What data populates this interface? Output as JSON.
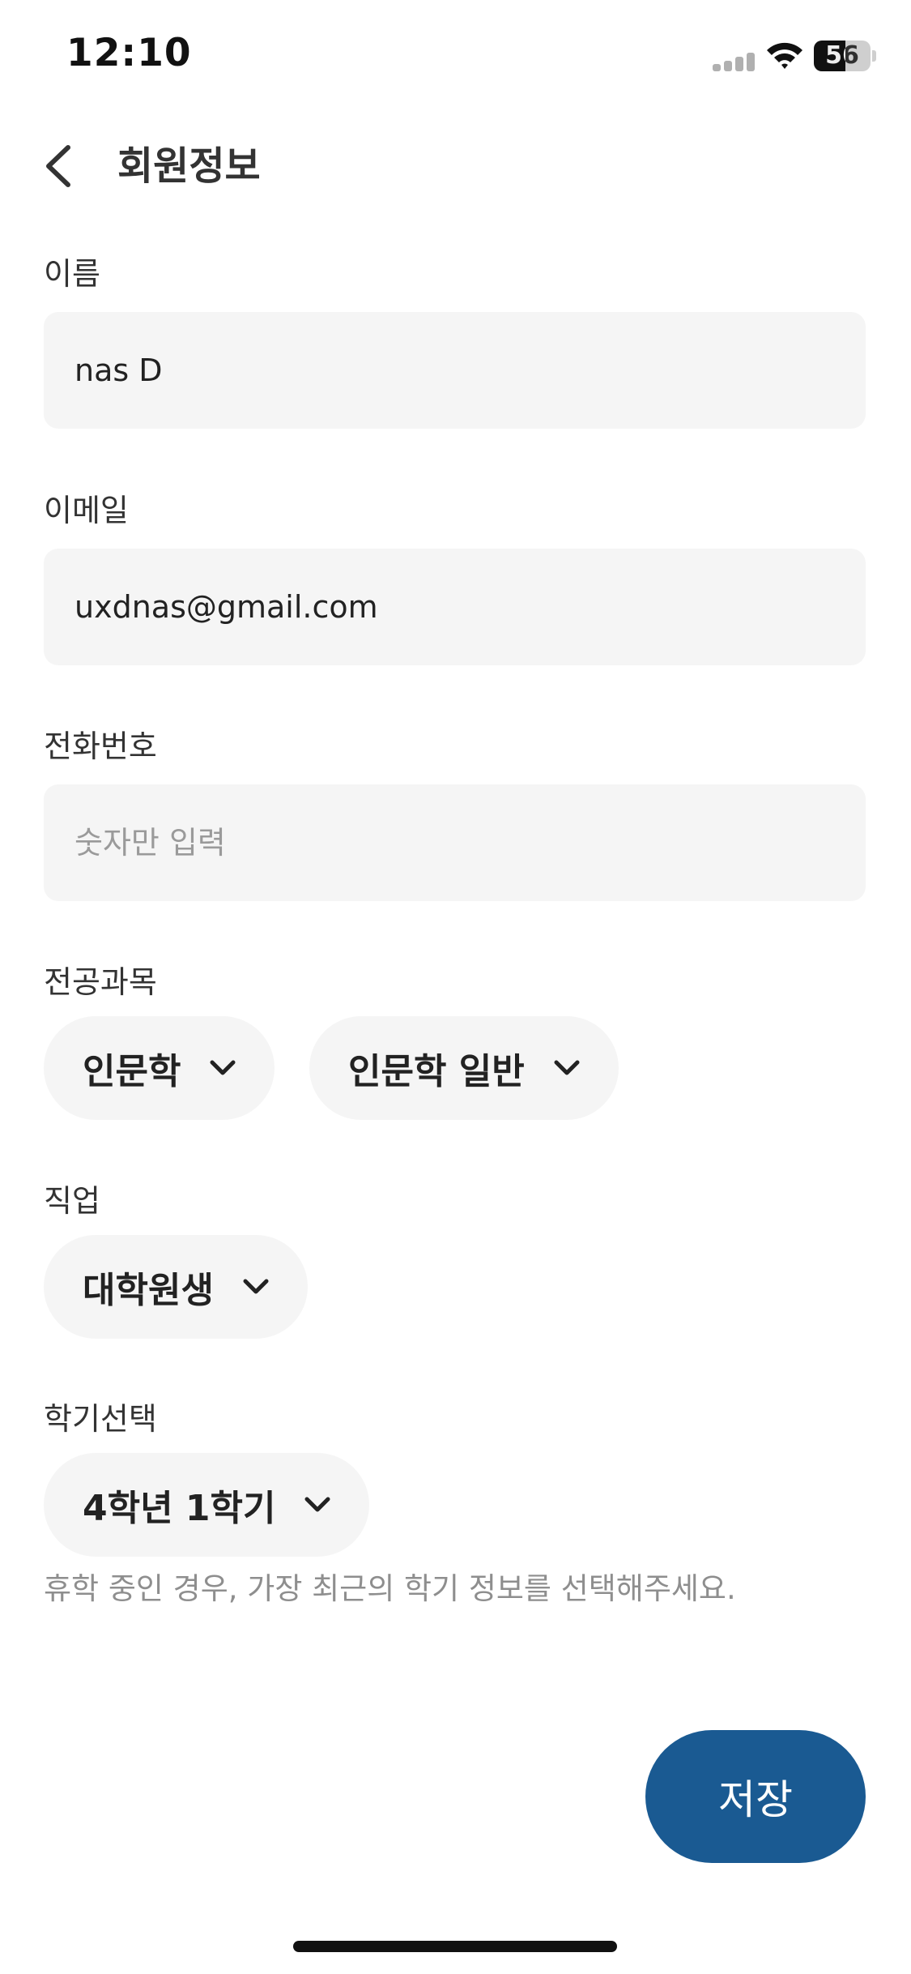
{
  "status_bar": {
    "time": "12:10",
    "battery_level": "56",
    "battery_fraction": 0.56
  },
  "header": {
    "back_icon": "chevron-left-icon",
    "title": "회원정보"
  },
  "form": {
    "name": {
      "label": "이름",
      "value": "nas D"
    },
    "email": {
      "label": "이메일",
      "value": "uxdnas@gmail.com"
    },
    "phone": {
      "label": "전화번호",
      "value": "",
      "placeholder": "숫자만 입력"
    },
    "major": {
      "label": "전공과목",
      "primary": "인문학",
      "secondary": "인문학 일반"
    },
    "job": {
      "label": "직업",
      "value": "대학원생"
    },
    "semester": {
      "label": "학기선택",
      "value": "4학년 1학기",
      "helper": "휴학 중인 경우, 가장 최근의 학기 정보를 선택해주세요."
    }
  },
  "actions": {
    "save_label": "저장"
  },
  "colors": {
    "primary": "#1a5a92",
    "field_bg": "#f5f5f5",
    "muted_text": "#8e8e8e"
  }
}
